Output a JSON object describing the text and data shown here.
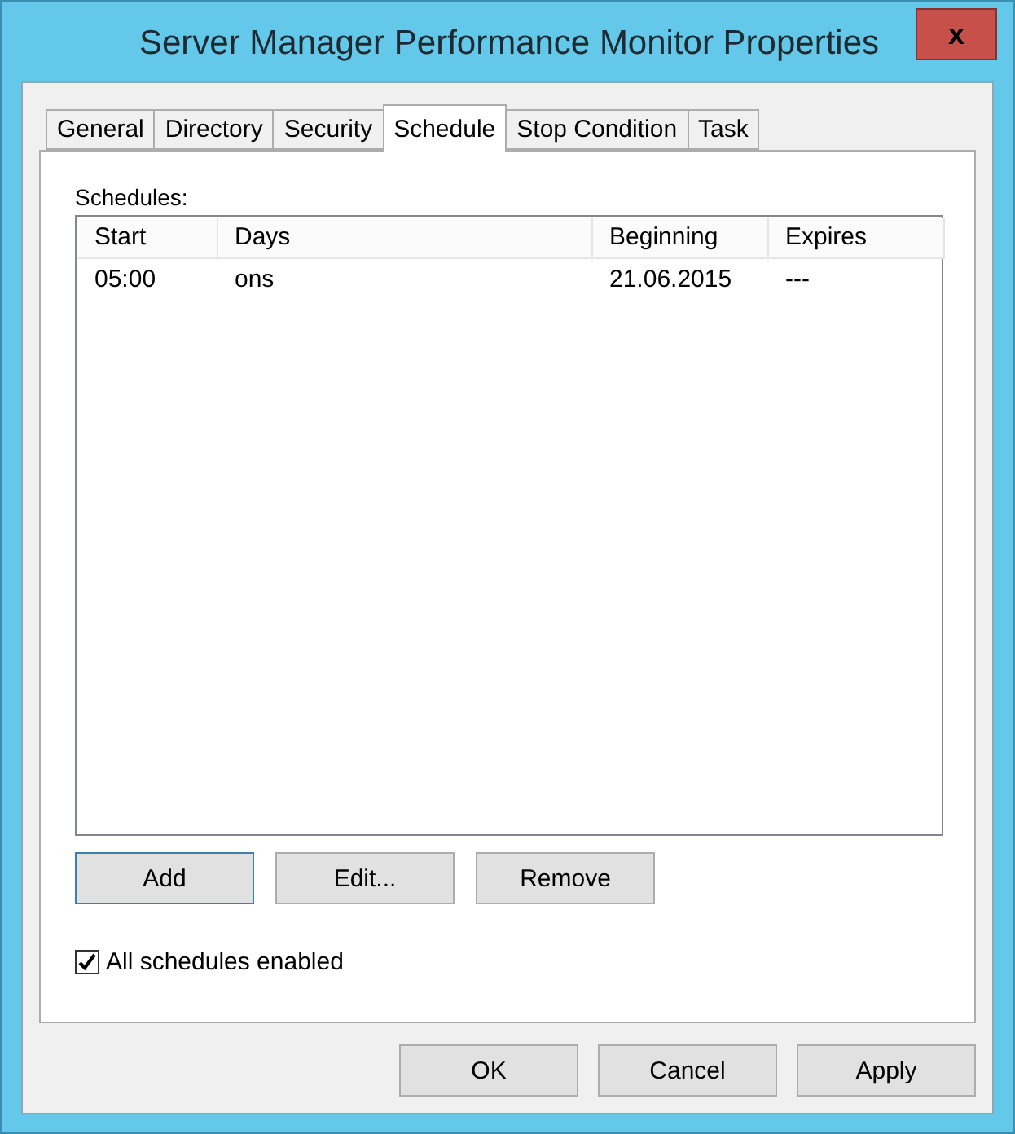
{
  "window": {
    "title": "Server Manager Performance Monitor Properties",
    "close": "x"
  },
  "tabs": [
    {
      "label": "General",
      "selected": false
    },
    {
      "label": "Directory",
      "selected": false
    },
    {
      "label": "Security",
      "selected": false
    },
    {
      "label": "Schedule",
      "selected": true
    },
    {
      "label": "Stop Condition",
      "selected": false
    },
    {
      "label": "Task",
      "selected": false
    }
  ],
  "schedules": {
    "label": "Schedules:",
    "columns": [
      "Start",
      "Days",
      "Beginning",
      "Expires"
    ],
    "rows": [
      [
        "05:00",
        "ons",
        "21.06.2015",
        "---"
      ]
    ]
  },
  "list_buttons": [
    {
      "label": "Add",
      "focused": true
    },
    {
      "label": "Edit...",
      "focused": false
    },
    {
      "label": "Remove",
      "focused": false
    }
  ],
  "all_schedules_enabled": {
    "label": "All schedules enabled",
    "checked": true
  },
  "dialog_buttons": [
    {
      "label": "OK",
      "focused": false
    },
    {
      "label": "Cancel",
      "focused": false
    },
    {
      "label": "Apply",
      "focused": false
    }
  ]
}
